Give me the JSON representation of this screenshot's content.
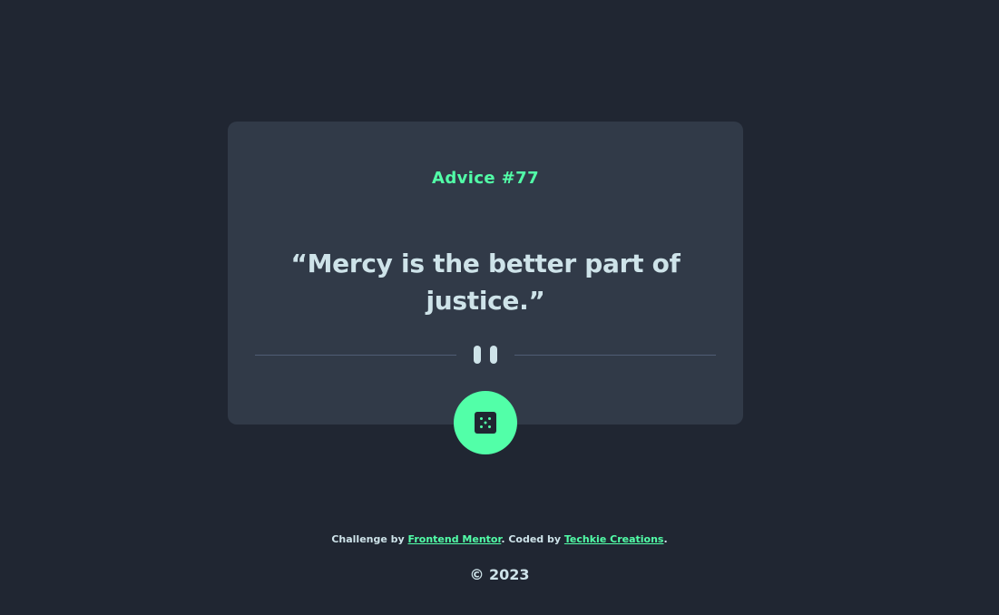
{
  "card": {
    "advice_id": "Advice #77",
    "quote": "“Mercy is the better part of justice.”"
  },
  "divider": {
    "icon": "pause-icon"
  },
  "dice_button": {
    "icon": "dice-icon",
    "color": "#52ffa8"
  },
  "footer": {
    "challenge_prefix": "Challenge by ",
    "challenge_link": "Frontend Mentor",
    "coded_prefix": ". Coded by ",
    "coded_link": "Techkie Creations",
    "suffix": ".",
    "copyright": "© 2023"
  },
  "colors": {
    "background": "#202632",
    "card": "#313a48",
    "accent": "#52ffa8",
    "text": "#cee3e9",
    "divider": "#4f5d74"
  }
}
